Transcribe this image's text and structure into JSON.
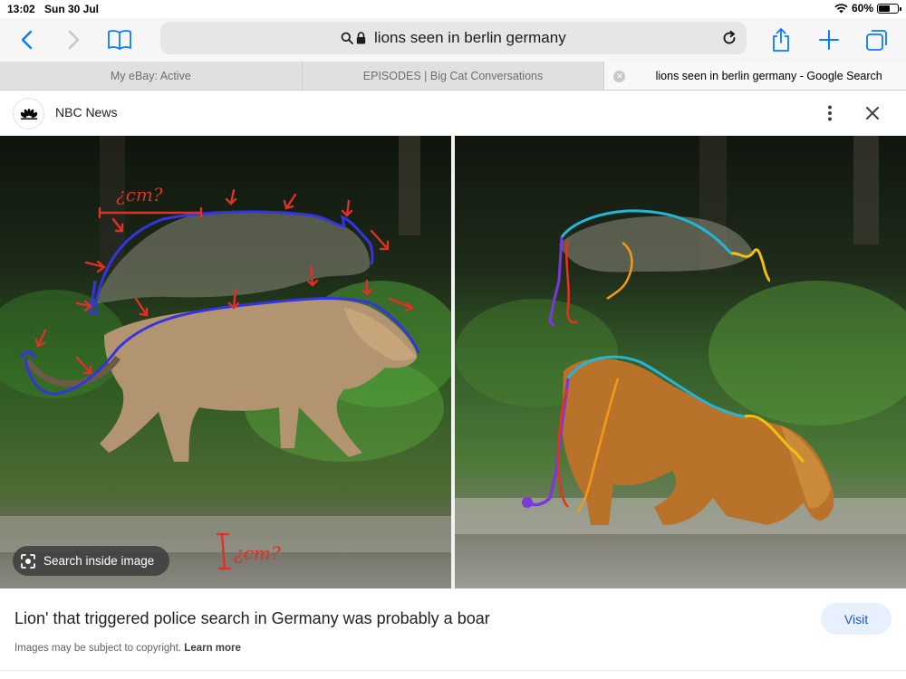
{
  "status": {
    "time": "13:02",
    "date": "Sun 30 Jul",
    "battery": "60%",
    "battery_level": 0.6
  },
  "toolbar": {
    "address": "lions seen in berlin germany",
    "icons": [
      "back-icon",
      "forward-icon",
      "bookmarks-icon",
      "search-icon",
      "lock-icon",
      "reload-icon",
      "share-icon",
      "new-tab-icon",
      "tabs-icon"
    ],
    "accent": "#0a7aff"
  },
  "tabs": [
    {
      "label": "My eBay: Active",
      "active": false
    },
    {
      "label": "EPISODES | Big Cat Conversations",
      "active": false
    },
    {
      "label": "lions seen in berlin germany - Google Search",
      "active": true
    }
  ],
  "header": {
    "source": "NBC News"
  },
  "image": {
    "annotations": [
      "¿cm?",
      "¿cm?"
    ],
    "search_inside": "Search inside image"
  },
  "footer": {
    "caption": "Lion' that triggered police search in Germany was probably a boar",
    "visit": "Visit",
    "copyright": "Images may be subject to copyright.",
    "learn_more": "Learn more"
  }
}
